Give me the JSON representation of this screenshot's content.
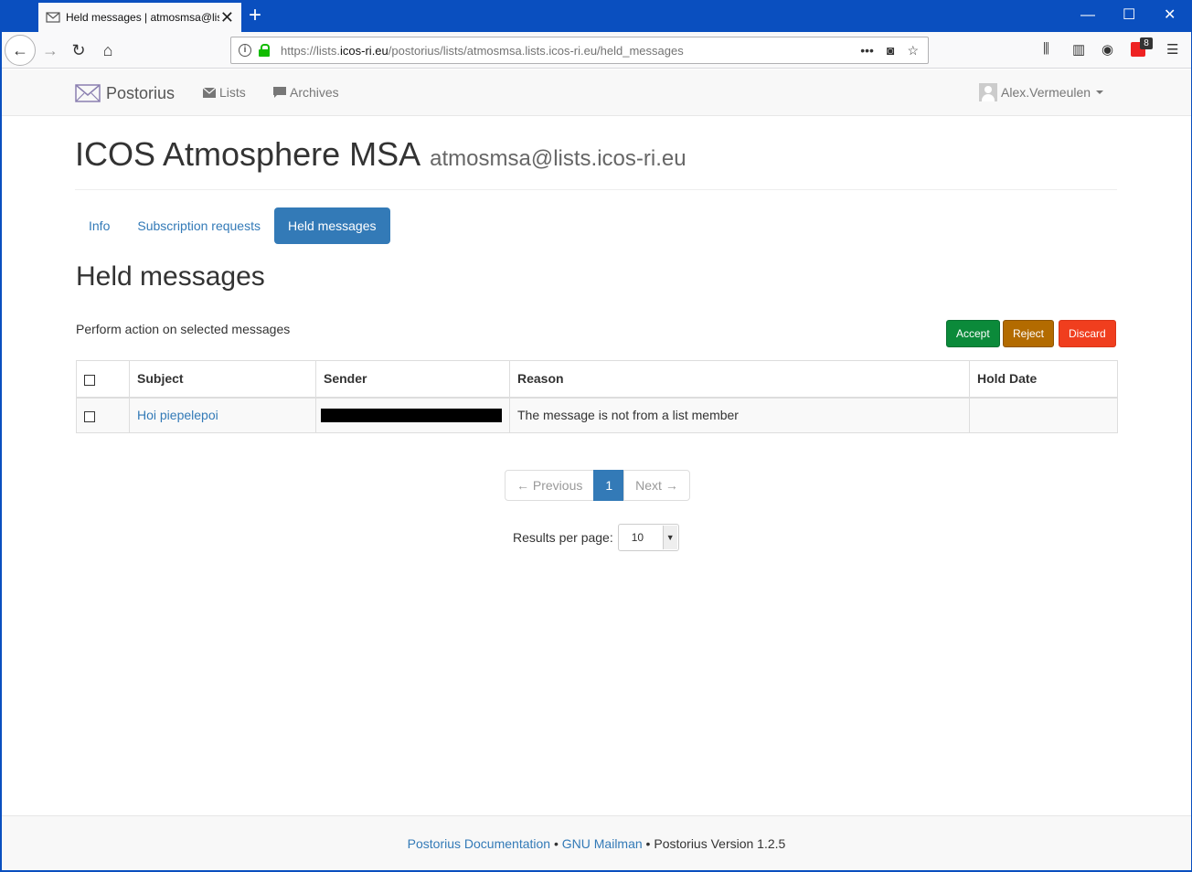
{
  "browser": {
    "tab_title": "Held messages | atmosmsa@lists.icos-ri.eu",
    "url_prefix": "https://lists.",
    "url_domain": "icos-ri.eu",
    "url_path": "/postorius/lists/atmosmsa.lists.icos-ri.eu/held_messages",
    "extension_badge": "8"
  },
  "nav": {
    "brand": "Postorius",
    "lists": "Lists",
    "archives": "Archives",
    "user": "Alex.Vermeulen"
  },
  "list": {
    "name": "ICOS Atmosphere MSA",
    "address": "atmosmsa@lists.icos-ri.eu"
  },
  "tabs": [
    {
      "label": "Info",
      "active": false
    },
    {
      "label": "Subscription requests",
      "active": false
    },
    {
      "label": "Held messages",
      "active": true
    }
  ],
  "main": {
    "heading": "Held messages",
    "perform_label": "Perform action on selected messages",
    "actions": {
      "accept": "Accept",
      "reject": "Reject",
      "discard": "Discard"
    }
  },
  "table": {
    "headers": [
      "Subject",
      "Sender",
      "Reason",
      "Hold Date"
    ],
    "rows": [
      {
        "subject": "Hoi piepelepoi",
        "sender": "",
        "reason": "The message is not from a list member",
        "hold_date": ""
      }
    ]
  },
  "pagination": {
    "previous": "← Previous",
    "current": "1",
    "next": "Next →"
  },
  "results_per_page": {
    "label": "Results per page:",
    "value": "10"
  },
  "footer": {
    "doc_link": "Postorius Documentation",
    "sep": " • ",
    "mailman_link": "GNU Mailman",
    "version": " • Postorius Version 1.2.5"
  },
  "colors": {
    "titlebar": "#0a4fbf",
    "link": "#337ab7",
    "accept": "#0b8a3a",
    "reject": "#b36b00",
    "discard": "#f03e1e"
  }
}
